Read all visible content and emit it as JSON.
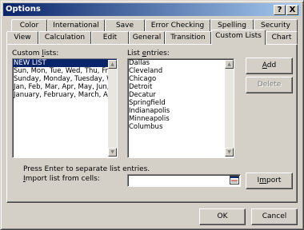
{
  "window": {
    "title": "Options",
    "help_glyph": "?",
    "close_glyph": "X"
  },
  "tabs_row1": [
    "Color",
    "International",
    "Save",
    "Error Checking",
    "Spelling",
    "Security"
  ],
  "tabs_row2": [
    "View",
    "Calculation",
    "Edit",
    "General",
    "Transition",
    "Custom Lists",
    "Chart"
  ],
  "active_tab": "Custom Lists",
  "custom_lists": {
    "label_pre": "Custom ",
    "label_u": "l",
    "label_post": "ists:",
    "items": [
      "NEW LIST",
      "Sun, Mon, Tue, Wed, Thu, Fri, S",
      "Sunday, Monday, Tuesday, Wed",
      "Jan, Feb, Mar, Apr, May, Jun, J",
      "January, February, March, April"
    ],
    "selected_index": 0
  },
  "list_entries": {
    "label_pre": "List ",
    "label_u": "e",
    "label_post": "ntries:",
    "items": [
      "Dallas",
      "Cleveland",
      "Chicago",
      "Detroit",
      "Decatur",
      "Springfield",
      "Indianapolis",
      "Minneapolis",
      "Columbus"
    ]
  },
  "buttons": {
    "add_u": "A",
    "add_rest": "dd",
    "delete": "Delete",
    "import_pre": "I",
    "import_u": "m",
    "import_post": "port",
    "ok": "OK",
    "cancel": "Cancel"
  },
  "hint": "Press Enter to separate list entries.",
  "import_label": {
    "u": "I",
    "rest": "mport list from cells:"
  },
  "import_value": "",
  "icons": {
    "scroll_up": "▲",
    "scroll_down": "▼",
    "collapse": "range-select-icon"
  }
}
